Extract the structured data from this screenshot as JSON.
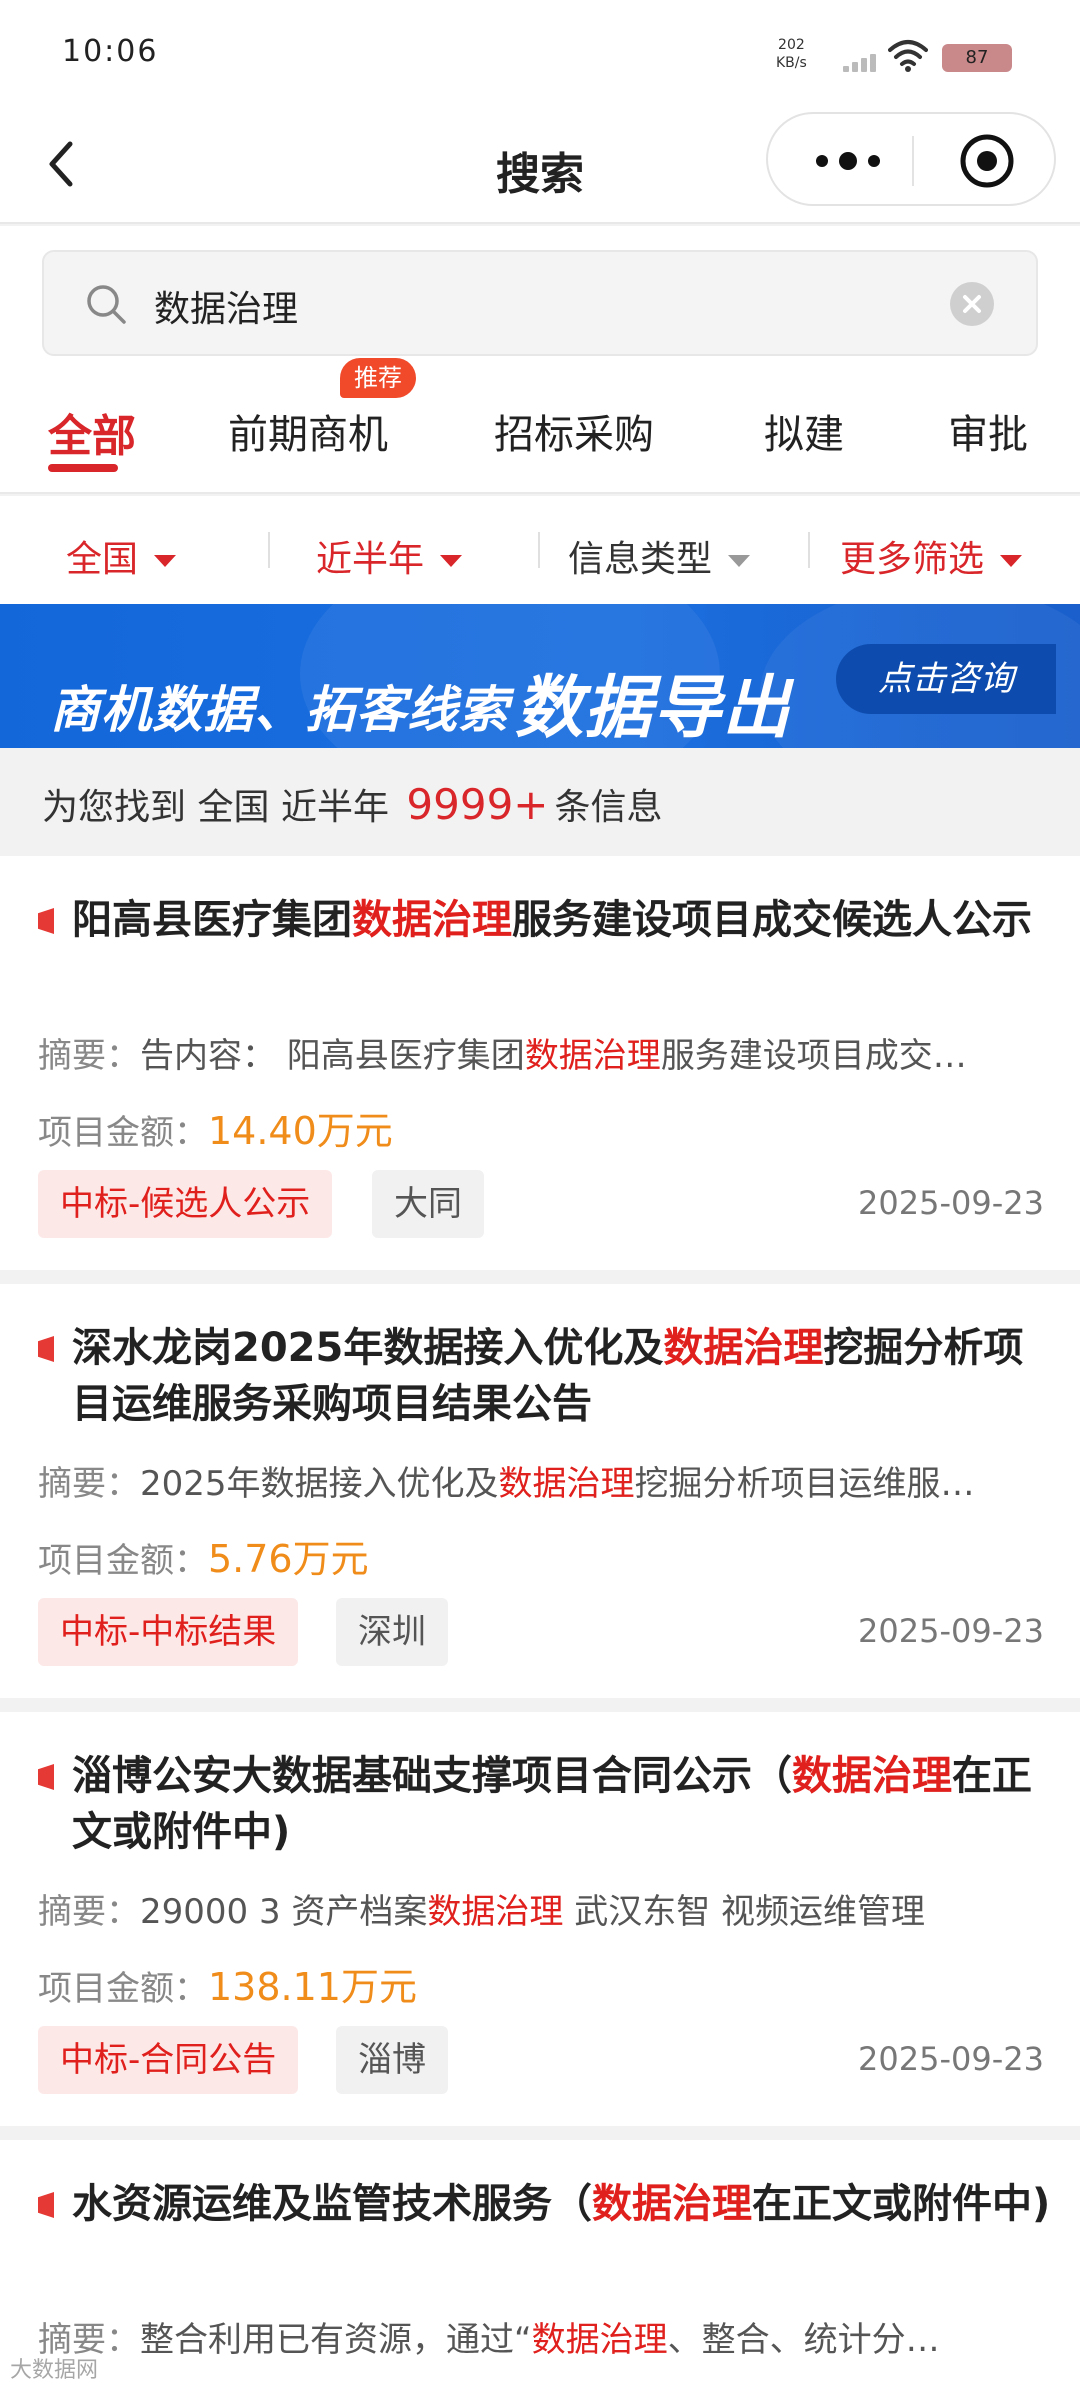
{
  "status_bar": {
    "time": "10:06",
    "net_speed": "202",
    "net_unit": "KB/s",
    "battery": "87"
  },
  "nav": {
    "title": "搜索"
  },
  "search": {
    "value": "数据治理"
  },
  "tabs": [
    {
      "label": "全部",
      "active": true
    },
    {
      "label": "前期商机",
      "badge": "推荐"
    },
    {
      "label": "招标采购"
    },
    {
      "label": "拟建"
    },
    {
      "label": "审批"
    }
  ],
  "filters": [
    "全国",
    "近半年",
    "信息类型",
    "更多筛选"
  ],
  "banner": {
    "text": "商机数据、拓客线索",
    "emphasis": "数据导出",
    "cta": "点击咨询"
  },
  "result_summary": {
    "prefix": "为您找到",
    "region": "全国",
    "period": "近半年",
    "count": "9999+",
    "suffix": "条信息"
  },
  "results": [
    {
      "title_pre": "阳高县医疗集团",
      "title_hl": "数据治理",
      "title_post": "服务建设项目成交候选人公示",
      "summary_label": "摘要：",
      "summary_pre": "告内容： 阳高县医疗集团",
      "summary_hl": "数据治理",
      "summary_post": "服务建设项目成交…",
      "amount_label": "项目金额：",
      "amount": "14.40万元",
      "tag": "中标-候选人公示",
      "region": "大同",
      "date": "2025-09-23"
    },
    {
      "title_pre": "深水龙岗2025年数据接入优化及",
      "title_hl": "数据治理",
      "title_post": "挖掘分析项目运维服务采购项目结果公告",
      "summary_label": "摘要：",
      "summary_pre": "2025年数据接入优化及",
      "summary_hl": "数据治理",
      "summary_post": "挖掘分析项目运维服…",
      "amount_label": "项目金额：",
      "amount": "5.76万元",
      "tag": "中标-中标结果",
      "region": "深圳",
      "date": "2025-09-23"
    },
    {
      "title_pre": "淄博公安大数据基础支撑项目合同公示（",
      "title_hl": "数据治理",
      "title_post": "在正文或附件中)",
      "summary_label": "摘要：",
      "summary_pre": "29000 3 资产档案",
      "summary_hl": "数据治理",
      "summary_post": " 武汉东智 视频运维管理",
      "amount_label": "项目金额：",
      "amount": "138.11万元",
      "tag": "中标-合同公告",
      "region": "淄博",
      "date": "2025-09-23"
    },
    {
      "title_pre": "水资源运维及监管技术服务（",
      "title_hl": "数据治理",
      "title_post": "在正文或附件中)",
      "summary_label": "摘要：",
      "summary_pre": "整合利用已有资源，通过“",
      "summary_hl": "数据治理",
      "summary_post": "、整合、统计分…"
    }
  ],
  "watermark": "大数据网"
}
